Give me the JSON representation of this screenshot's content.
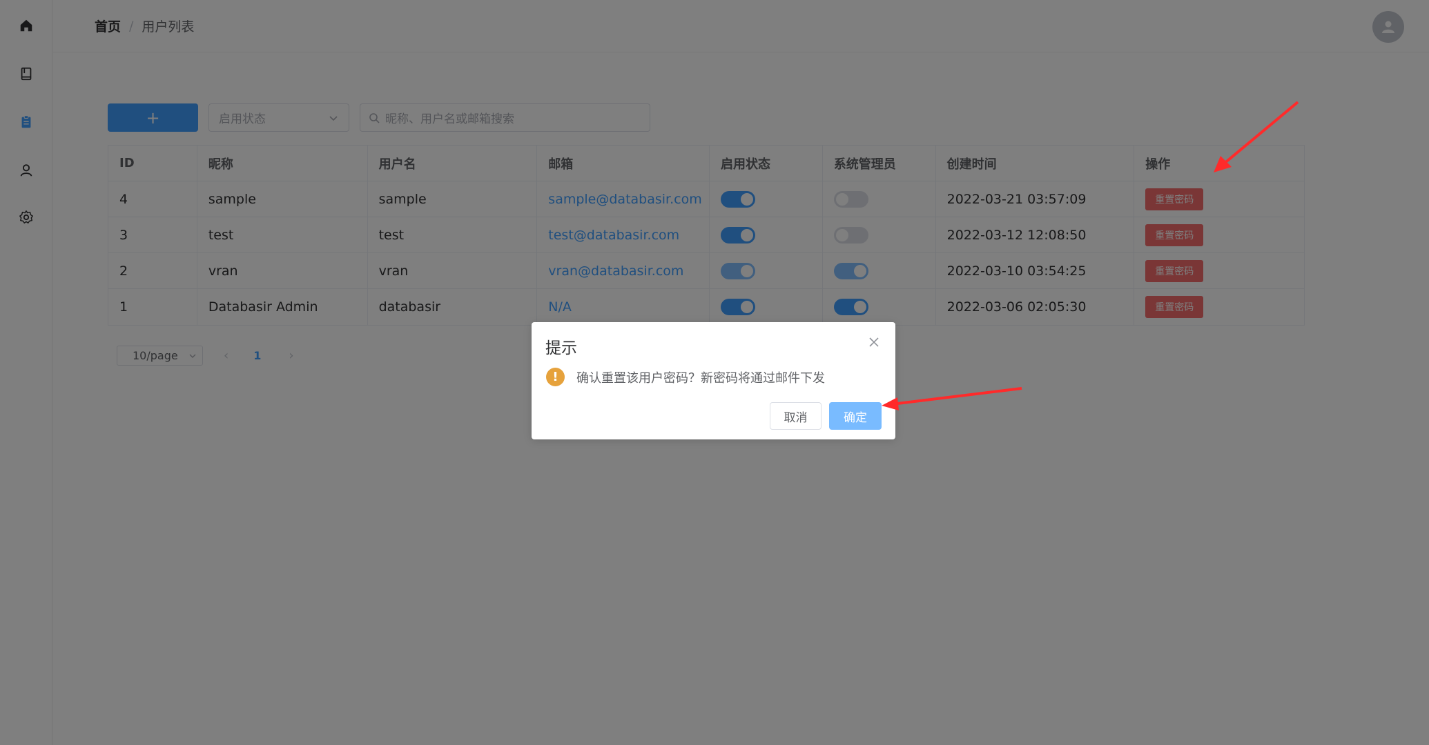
{
  "breadcrumb": {
    "home": "首页",
    "separator": "/",
    "current": "用户列表"
  },
  "toolbar": {
    "add_label": "+",
    "status_placeholder": "启用状态",
    "search_placeholder": "昵称、用户名或邮箱搜索"
  },
  "table": {
    "headers": {
      "id": "ID",
      "nickname": "昵称",
      "username": "用户名",
      "email": "邮箱",
      "enabled": "启用状态",
      "admin": "系统管理员",
      "created": "创建时间",
      "actions": "操作"
    },
    "rows": [
      {
        "id": "4",
        "nickname": "sample",
        "username": "sample",
        "email": "sample@databasir.com",
        "enabled": true,
        "admin": false,
        "created": "2022-03-21 03:57:09",
        "action": "重置密码"
      },
      {
        "id": "3",
        "nickname": "test",
        "username": "test",
        "email": "test@databasir.com",
        "enabled": true,
        "admin": false,
        "created": "2022-03-12 12:08:50",
        "action": "重置密码"
      },
      {
        "id": "2",
        "nickname": "vran",
        "username": "vran",
        "email": "vran@databasir.com",
        "enabled": true,
        "admin": true,
        "created": "2022-03-10 03:54:25",
        "action": "重置密码"
      },
      {
        "id": "1",
        "nickname": "Databasir Admin",
        "username": "databasir",
        "email": "N/A",
        "enabled": true,
        "admin": true,
        "created": "2022-03-06 02:05:30",
        "action": "重置密码"
      }
    ]
  },
  "pagination": {
    "page_size": "10/page",
    "current_page": "1"
  },
  "dialog": {
    "title": "提示",
    "message": "确认重置该用户密码？新密码将通过邮件下发",
    "cancel_label": "取消",
    "confirm_label": "确定"
  },
  "colors": {
    "primary": "#409eff",
    "danger": "#f56c6c",
    "warning": "#e6a23c",
    "annotation": "#ff2a2a"
  }
}
